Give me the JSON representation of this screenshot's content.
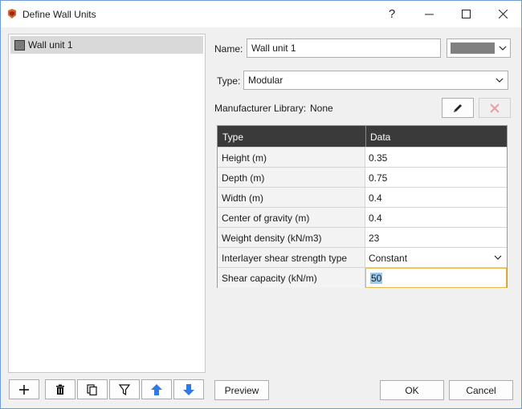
{
  "window": {
    "title": "Define Wall Units",
    "help_glyph": "?",
    "minimize_glyph": "—",
    "maximize_glyph": "☐",
    "close_glyph": "✕"
  },
  "list": {
    "items": [
      {
        "label": "Wall unit 1",
        "swatch_color": "#7a7a7a"
      }
    ]
  },
  "toolbar": {
    "icons": [
      "add-icon",
      "delete-icon",
      "copy-icon",
      "filter-icon",
      "move-up-icon",
      "move-down-icon"
    ]
  },
  "form": {
    "name_label": "Name:",
    "name_value": "Wall unit 1",
    "color_value": "#808080",
    "type_label": "Type:",
    "type_value": "Modular",
    "library_label": "Manufacturer Library:",
    "library_value": "None"
  },
  "table": {
    "headers": [
      "Type",
      "Data"
    ],
    "rows": [
      {
        "label": "Height (m)",
        "value": "0.35"
      },
      {
        "label": "Depth (m)",
        "value": "0.75"
      },
      {
        "label": "Width (m)",
        "value": "0.4"
      },
      {
        "label": "Center of gravity (m)",
        "value": "0.4"
      },
      {
        "label": "Weight density (kN/m3)",
        "value": "23"
      },
      {
        "label": "Interlayer shear strength type",
        "value": "Constant"
      },
      {
        "label": "Shear capacity (kN/m)",
        "value": "50"
      }
    ]
  },
  "buttons": {
    "preview": "Preview",
    "ok": "OK",
    "cancel": "Cancel"
  },
  "colors": {
    "header_bg": "#3a3a3a",
    "delete_x": "#e8a0a0",
    "arrow_blue": "#2f7ae5",
    "edit_border": "#e6b84a"
  }
}
